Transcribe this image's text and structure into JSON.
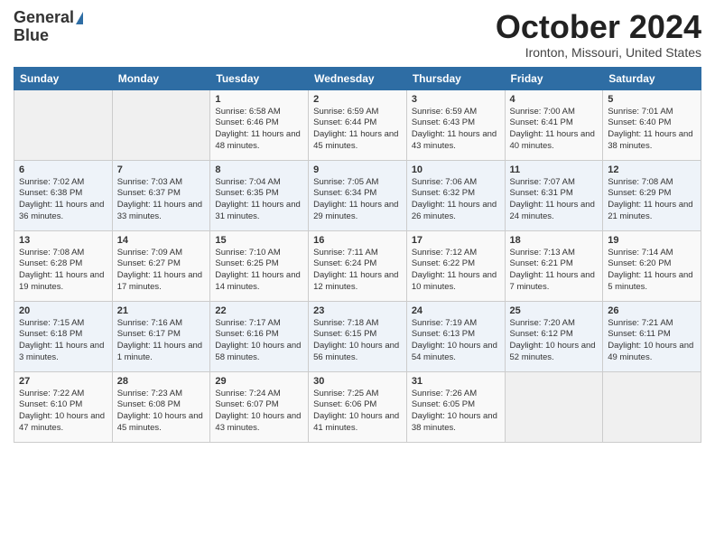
{
  "header": {
    "logo_line1": "General",
    "logo_line2": "Blue",
    "month_title": "October 2024",
    "location": "Ironton, Missouri, United States"
  },
  "days_of_week": [
    "Sunday",
    "Monday",
    "Tuesday",
    "Wednesday",
    "Thursday",
    "Friday",
    "Saturday"
  ],
  "weeks": [
    [
      {
        "day": "",
        "content": ""
      },
      {
        "day": "",
        "content": ""
      },
      {
        "day": "1",
        "content": "Sunrise: 6:58 AM\nSunset: 6:46 PM\nDaylight: 11 hours and 48 minutes."
      },
      {
        "day": "2",
        "content": "Sunrise: 6:59 AM\nSunset: 6:44 PM\nDaylight: 11 hours and 45 minutes."
      },
      {
        "day": "3",
        "content": "Sunrise: 6:59 AM\nSunset: 6:43 PM\nDaylight: 11 hours and 43 minutes."
      },
      {
        "day": "4",
        "content": "Sunrise: 7:00 AM\nSunset: 6:41 PM\nDaylight: 11 hours and 40 minutes."
      },
      {
        "day": "5",
        "content": "Sunrise: 7:01 AM\nSunset: 6:40 PM\nDaylight: 11 hours and 38 minutes."
      }
    ],
    [
      {
        "day": "6",
        "content": "Sunrise: 7:02 AM\nSunset: 6:38 PM\nDaylight: 11 hours and 36 minutes."
      },
      {
        "day": "7",
        "content": "Sunrise: 7:03 AM\nSunset: 6:37 PM\nDaylight: 11 hours and 33 minutes."
      },
      {
        "day": "8",
        "content": "Sunrise: 7:04 AM\nSunset: 6:35 PM\nDaylight: 11 hours and 31 minutes."
      },
      {
        "day": "9",
        "content": "Sunrise: 7:05 AM\nSunset: 6:34 PM\nDaylight: 11 hours and 29 minutes."
      },
      {
        "day": "10",
        "content": "Sunrise: 7:06 AM\nSunset: 6:32 PM\nDaylight: 11 hours and 26 minutes."
      },
      {
        "day": "11",
        "content": "Sunrise: 7:07 AM\nSunset: 6:31 PM\nDaylight: 11 hours and 24 minutes."
      },
      {
        "day": "12",
        "content": "Sunrise: 7:08 AM\nSunset: 6:29 PM\nDaylight: 11 hours and 21 minutes."
      }
    ],
    [
      {
        "day": "13",
        "content": "Sunrise: 7:08 AM\nSunset: 6:28 PM\nDaylight: 11 hours and 19 minutes."
      },
      {
        "day": "14",
        "content": "Sunrise: 7:09 AM\nSunset: 6:27 PM\nDaylight: 11 hours and 17 minutes."
      },
      {
        "day": "15",
        "content": "Sunrise: 7:10 AM\nSunset: 6:25 PM\nDaylight: 11 hours and 14 minutes."
      },
      {
        "day": "16",
        "content": "Sunrise: 7:11 AM\nSunset: 6:24 PM\nDaylight: 11 hours and 12 minutes."
      },
      {
        "day": "17",
        "content": "Sunrise: 7:12 AM\nSunset: 6:22 PM\nDaylight: 11 hours and 10 minutes."
      },
      {
        "day": "18",
        "content": "Sunrise: 7:13 AM\nSunset: 6:21 PM\nDaylight: 11 hours and 7 minutes."
      },
      {
        "day": "19",
        "content": "Sunrise: 7:14 AM\nSunset: 6:20 PM\nDaylight: 11 hours and 5 minutes."
      }
    ],
    [
      {
        "day": "20",
        "content": "Sunrise: 7:15 AM\nSunset: 6:18 PM\nDaylight: 11 hours and 3 minutes."
      },
      {
        "day": "21",
        "content": "Sunrise: 7:16 AM\nSunset: 6:17 PM\nDaylight: 11 hours and 1 minute."
      },
      {
        "day": "22",
        "content": "Sunrise: 7:17 AM\nSunset: 6:16 PM\nDaylight: 10 hours and 58 minutes."
      },
      {
        "day": "23",
        "content": "Sunrise: 7:18 AM\nSunset: 6:15 PM\nDaylight: 10 hours and 56 minutes."
      },
      {
        "day": "24",
        "content": "Sunrise: 7:19 AM\nSunset: 6:13 PM\nDaylight: 10 hours and 54 minutes."
      },
      {
        "day": "25",
        "content": "Sunrise: 7:20 AM\nSunset: 6:12 PM\nDaylight: 10 hours and 52 minutes."
      },
      {
        "day": "26",
        "content": "Sunrise: 7:21 AM\nSunset: 6:11 PM\nDaylight: 10 hours and 49 minutes."
      }
    ],
    [
      {
        "day": "27",
        "content": "Sunrise: 7:22 AM\nSunset: 6:10 PM\nDaylight: 10 hours and 47 minutes."
      },
      {
        "day": "28",
        "content": "Sunrise: 7:23 AM\nSunset: 6:08 PM\nDaylight: 10 hours and 45 minutes."
      },
      {
        "day": "29",
        "content": "Sunrise: 7:24 AM\nSunset: 6:07 PM\nDaylight: 10 hours and 43 minutes."
      },
      {
        "day": "30",
        "content": "Sunrise: 7:25 AM\nSunset: 6:06 PM\nDaylight: 10 hours and 41 minutes."
      },
      {
        "day": "31",
        "content": "Sunrise: 7:26 AM\nSunset: 6:05 PM\nDaylight: 10 hours and 38 minutes."
      },
      {
        "day": "",
        "content": ""
      },
      {
        "day": "",
        "content": ""
      }
    ]
  ]
}
